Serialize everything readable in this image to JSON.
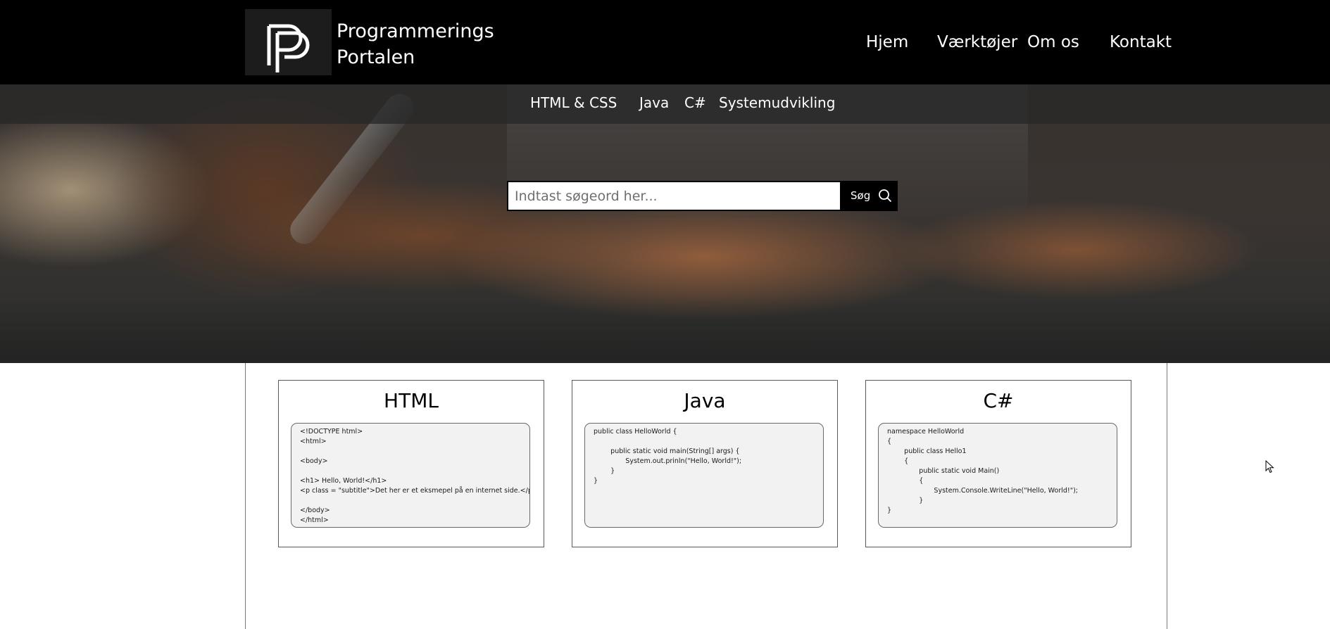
{
  "brand": {
    "line1": "Programmerings",
    "line2": "Portalen"
  },
  "main_nav": {
    "items": [
      {
        "label": "Hjem"
      },
      {
        "label": "Værktøjer"
      },
      {
        "label": "Om os"
      },
      {
        "label": "Kontakt"
      }
    ]
  },
  "sub_nav": {
    "items": [
      {
        "label": "HTML & CSS"
      },
      {
        "label": "Java"
      },
      {
        "label": "C#"
      },
      {
        "label": "Systemudvikling"
      }
    ]
  },
  "search": {
    "placeholder": "Indtast søgeord her...",
    "value": "",
    "button_label": "Søg"
  },
  "cards": [
    {
      "title": "HTML",
      "code": [
        "<!DOCTYPE html>",
        "<html>",
        "",
        "<body>",
        "",
        "<h1> Hello, World!</h1>",
        "<p class = \"subtitle\">Det her er et eksmepel på en internet side.</p>",
        "",
        "</body>",
        "</html>"
      ]
    },
    {
      "title": "Java",
      "code": [
        "public class HelloWorld {",
        "",
        "        public static void main(String[] args) {",
        "               System.out.prinln(\"Hello, World!\");",
        "        }",
        "}"
      ]
    },
    {
      "title": "C#",
      "code": [
        "namespace HelloWorld",
        "{",
        "        public class Hello1",
        "        {",
        "               public static void Main()",
        "               {",
        "                      System.Console.WriteLine(\"Hello, World!\");",
        "               }",
        "}"
      ]
    }
  ],
  "colors": {
    "header_bg": "#000000",
    "subnav_bg": "#282828",
    "code_bg": "#f2f2f2",
    "text": "#000000"
  },
  "icons": {
    "logo": "pp-logo",
    "search": "search-icon",
    "cursor": "mouse-pointer-icon"
  }
}
